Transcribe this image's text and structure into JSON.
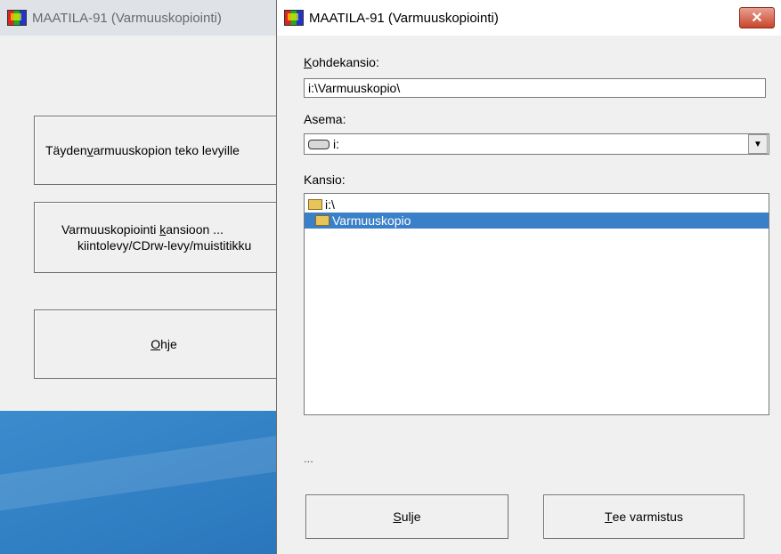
{
  "background_window": {
    "title": "MAATILA-91 (Varmuuskopiointi)",
    "buttons": [
      {
        "before": "Täyden ",
        "accel": "v",
        "after": "armuuskopion teko levyille"
      },
      {
        "line1_before": "Varmuuskopiointi ",
        "line1_accel": "k",
        "line1_after": "ansioon ...",
        "line2": "kiintolevy/CDrw-levy/muistitikku"
      },
      {
        "before": "",
        "accel": "O",
        "after": "hje"
      }
    ]
  },
  "dialog": {
    "title": "MAATILA-91 (Varmuuskopiointi)",
    "close_glyph": "✕",
    "target_folder": {
      "label_accel": "K",
      "label_rest": "ohdekansio:",
      "value": "i:\\Varmuuskopio\\"
    },
    "drive": {
      "label": "Asema:",
      "value": "i:",
      "icon": "drive-icon",
      "arrow": "▼"
    },
    "folder": {
      "label": "Kansio:",
      "items": [
        {
          "text": "i:\\",
          "icon": "folder-open-icon",
          "selected": false
        },
        {
          "text": "Varmuuskopio",
          "icon": "folder-open-icon",
          "selected": true
        }
      ]
    },
    "status": "...",
    "close_button": {
      "accel": "S",
      "rest": "ulje"
    },
    "backup_button": {
      "accel": "T",
      "rest": "ee varmistus"
    }
  },
  "colors": {
    "selection": "#3a80c8",
    "desktop": "#3d8fd0",
    "close": "#c8452c"
  }
}
